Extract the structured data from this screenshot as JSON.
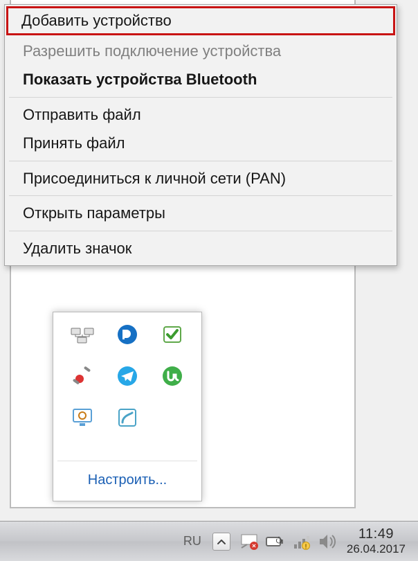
{
  "context_menu": {
    "items": [
      {
        "label": "Добавить устройство",
        "bold": false,
        "disabled": false,
        "highlight": true
      },
      {
        "label": "Разрешить подключение устройства",
        "bold": false,
        "disabled": true
      },
      {
        "label": "Показать устройства Bluetooth",
        "bold": true,
        "disabled": false
      },
      "sep",
      {
        "label": "Отправить файл",
        "bold": false,
        "disabled": false
      },
      {
        "label": "Принять файл",
        "bold": false,
        "disabled": false
      },
      "sep",
      {
        "label": "Присоединиться к личной сети (PAN)",
        "bold": false,
        "disabled": false
      },
      "sep",
      {
        "label": "Открыть параметры",
        "bold": false,
        "disabled": false
      },
      "sep",
      {
        "label": "Удалить значок",
        "bold": false,
        "disabled": false
      }
    ]
  },
  "tray_flyout": {
    "customize_label": "Настроить...",
    "icons": [
      "device-icon",
      "perisonic-icon",
      "check-icon",
      "satellite-icon",
      "telegram-icon",
      "utorrent-icon",
      "monitor-icon",
      "app-icon"
    ]
  },
  "taskbar": {
    "language": "RU",
    "time": "11:49",
    "date": "26.04.2017",
    "sys_icons": [
      "action-center-icon",
      "power-icon",
      "network-icon",
      "volume-icon"
    ]
  }
}
